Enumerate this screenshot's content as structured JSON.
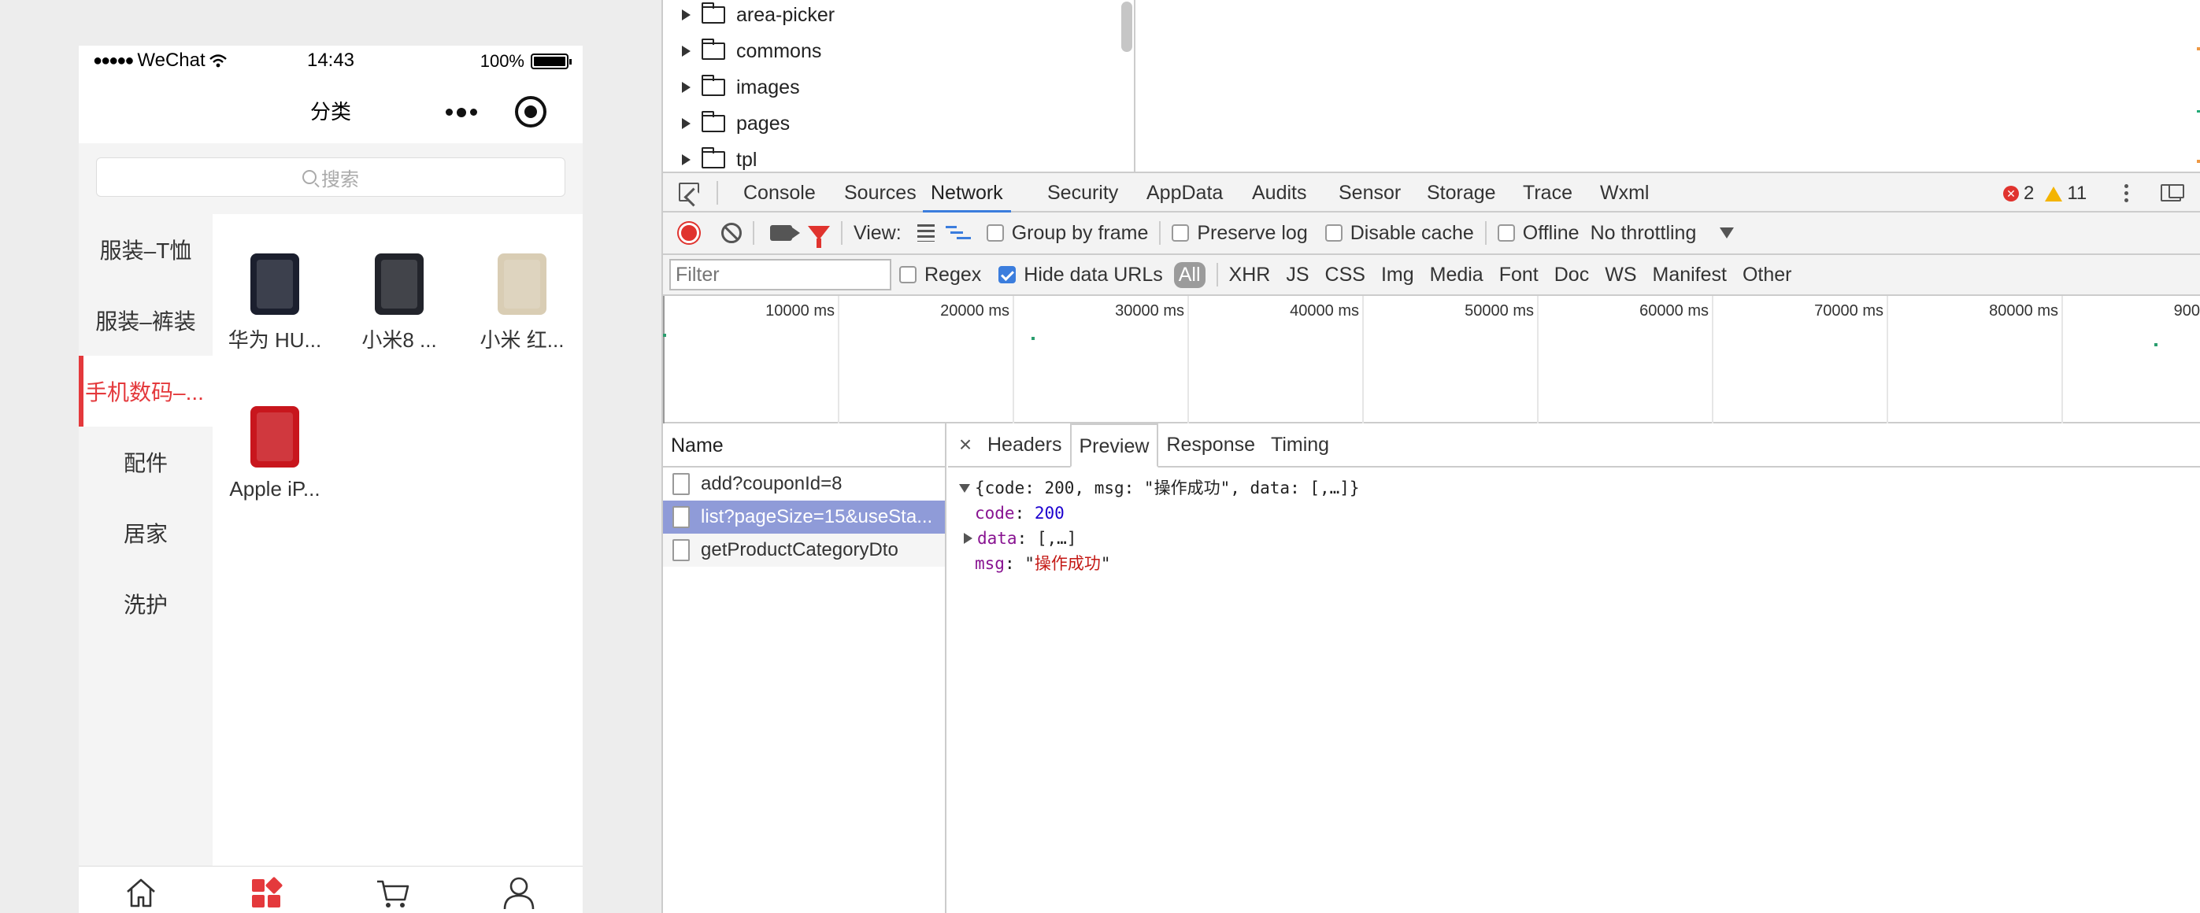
{
  "phone": {
    "status": {
      "carrier": "WeChat",
      "time": "14:43",
      "battery": "100%"
    },
    "title": "分类",
    "search_placeholder": "搜索",
    "categories": [
      {
        "label": "服装–T恤",
        "active": false
      },
      {
        "label": "服装–裤装",
        "active": false
      },
      {
        "label": "手机数码–...",
        "active": true
      },
      {
        "label": "配件",
        "active": false
      },
      {
        "label": "居家",
        "active": false
      },
      {
        "label": "洗护",
        "active": false
      }
    ],
    "products": [
      {
        "name": "华为 HU...",
        "color": "#1b1f2e"
      },
      {
        "name": "小米8 ...",
        "color": "#22242b"
      },
      {
        "name": "小米 红...",
        "color": "#d9cdb4"
      },
      {
        "name": "Apple iP...",
        "color": "#c8161d"
      }
    ],
    "tabbar": [
      "home-icon",
      "category-icon",
      "cart-icon",
      "user-icon"
    ],
    "accent": "#e4393c"
  },
  "devtools": {
    "filetree": [
      "area-picker",
      "commons",
      "images",
      "pages",
      "tpl"
    ],
    "tabs": [
      "Console",
      "Sources",
      "Network",
      "Security",
      "AppData",
      "Audits",
      "Sensor",
      "Storage",
      "Trace",
      "Wxml"
    ],
    "active_tab": "Network",
    "errors": "2",
    "warnings": "11",
    "toolbar": {
      "view_label": "View:",
      "group_by_frame": "Group by frame",
      "preserve_log": "Preserve log",
      "disable_cache": "Disable cache",
      "offline": "Offline",
      "throttling": "No throttling"
    },
    "filter": {
      "placeholder": "Filter",
      "regex": "Regex",
      "hide_data_urls": "Hide data URLs",
      "types": [
        "All",
        "XHR",
        "JS",
        "CSS",
        "Img",
        "Media",
        "Font",
        "Doc",
        "WS",
        "Manifest",
        "Other"
      ]
    },
    "timeline_ticks": [
      "10000 ms",
      "20000 ms",
      "30000 ms",
      "40000 ms",
      "50000 ms",
      "60000 ms",
      "70000 ms",
      "80000 ms",
      "900"
    ],
    "requests": {
      "header": "Name",
      "items": [
        "add?couponId=8",
        "list?pageSize=15&useSta...",
        "getProductCategoryDto"
      ],
      "selected": 1
    },
    "detail_tabs": [
      "Headers",
      "Preview",
      "Response",
      "Timing"
    ],
    "active_detail_tab": "Preview",
    "preview": {
      "summary": "{code: 200, msg: \"操作成功\", data: [,…]}",
      "code_key": "code",
      "code_value": "200",
      "data_key": "data",
      "data_value": "[,…]",
      "msg_key": "msg",
      "msg_value": "操作成功"
    }
  }
}
